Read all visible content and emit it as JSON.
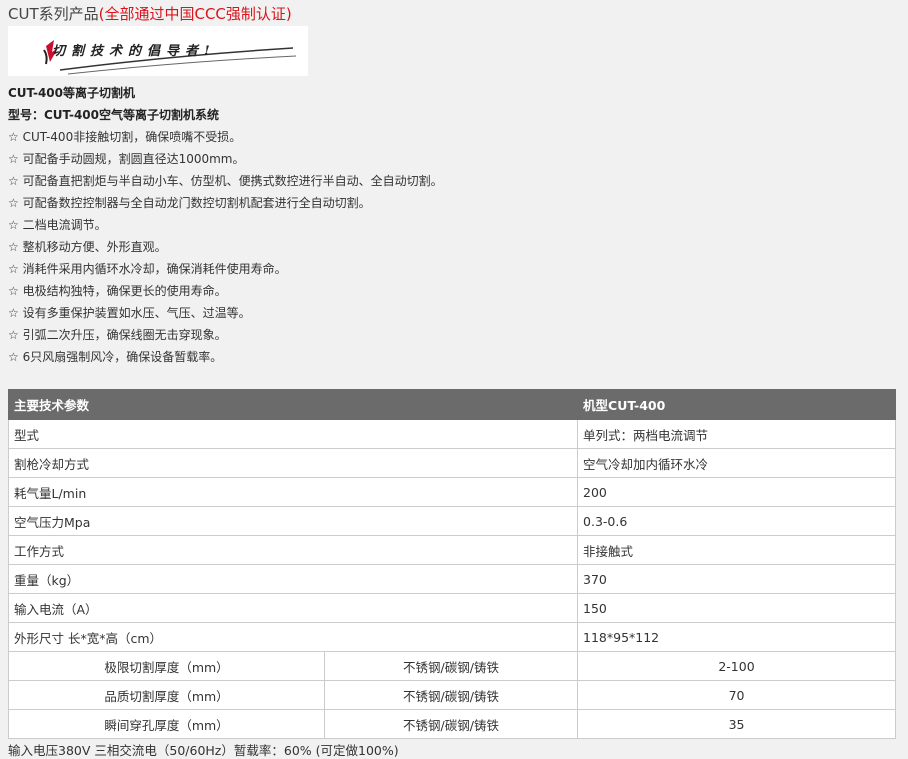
{
  "header": {
    "title": "CUT系列产品",
    "note": "(全部通过中国CCC强制认证)"
  },
  "banner": {
    "slogan": "切割技术的倡导者!"
  },
  "product": {
    "name": "CUT-400等离子切割机",
    "model": "型号：CUT-400空气等离子切割机系统"
  },
  "features": [
    "☆ CUT-400非接触切割，确保喷嘴不受损。",
    "☆ 可配备手动圆规，割圆直径达1000mm。",
    "☆ 可配备直把割炬与半自动小车、仿型机、便携式数控进行半自动、全自动切割。",
    "☆ 可配备数控控制器与全自动龙门数控切割机配套进行全自动切割。",
    "☆ 二档电流调节。",
    "☆ 整机移动方便、外形直观。",
    "☆ 消耗件采用内循环水冷却，确保消耗件使用寿命。",
    "☆ 电极结构独特，确保更长的使用寿命。",
    "☆ 设有多重保护装置如水压、气压、过温等。",
    "☆ 引弧二次升压，确保线圈无击穿现象。",
    "☆ 6只风扇强制风冷，确保设备暂载率。"
  ],
  "specs": {
    "header": [
      "主要技术参数",
      "机型CUT-400"
    ],
    "rows": [
      [
        "型式",
        "单列式：两档电流调节"
      ],
      [
        "割枪冷却方式",
        "空气冷却加内循环水冷"
      ],
      [
        "耗气量L/min",
        "200"
      ],
      [
        "空气压力Mpa",
        "0.3-0.6"
      ],
      [
        "工作方式",
        "非接触式"
      ],
      [
        "重量（kg）",
        "370"
      ],
      [
        "输入电流（A）",
        "150"
      ],
      [
        "外形尺寸 长*宽*高（cm）",
        "118*95*112"
      ]
    ],
    "thickness_rows": [
      [
        "极限切割厚度（mm）",
        "不锈钢/碳钢/铸铁",
        "2-100"
      ],
      [
        "品质切割厚度（mm）",
        "不锈钢/碳钢/铸铁",
        "70"
      ],
      [
        "瞬间穿孔厚度（mm）",
        "不锈钢/碳钢/铸铁",
        "35"
      ]
    ]
  },
  "footer": {
    "text": "输入电压380V 三相交流电（50/60Hz）暂载率：60% (可定做100%)"
  },
  "colors": {
    "accent_red": "#d9141b",
    "table_header": "#6b6b6b"
  }
}
